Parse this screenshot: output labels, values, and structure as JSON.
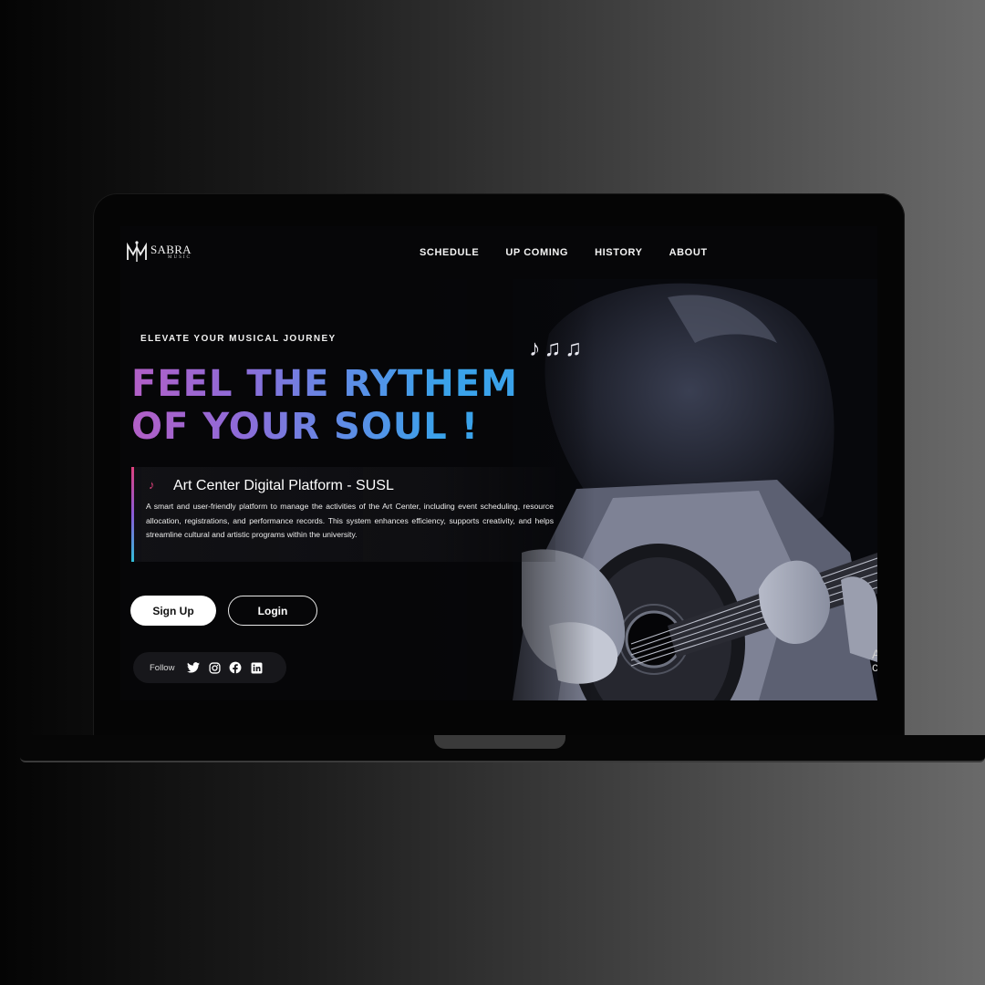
{
  "logo": {
    "name": "SABRA",
    "sub": "MUSIC"
  },
  "nav": {
    "items": [
      {
        "label": "SCHEDULE"
      },
      {
        "label": "UP COMING"
      },
      {
        "label": "HISTORY"
      },
      {
        "label": "ABOUT"
      }
    ]
  },
  "hero": {
    "eyebrow": "ELEVATE YOUR MUSICAL JOURNEY",
    "music_notes": "♪♫♫",
    "headline_line1": "FEEL THE RYTHEM",
    "headline_line2": "OF YOUR SOUL !",
    "gradient_colors": [
      "#b25fc6",
      "#8e6bd8",
      "#5f8ce6",
      "#3aa2ea"
    ]
  },
  "info": {
    "icon": "music-note-icon",
    "title": "Art Center Digital Platform - SUSL",
    "description": "A smart and user-friendly platform to manage the activities of the Art Center, including event scheduling, resource allocation, registrations, and performance records. This system enhances efficiency, supports creativity, and helps streamline cultural and artistic programs within the university."
  },
  "buttons": {
    "signup": "Sign Up",
    "login": "Login"
  },
  "follow": {
    "label": "Follow",
    "icons": [
      "twitter-icon",
      "instagram-icon",
      "facebook-icon",
      "linkedin-icon"
    ]
  },
  "colors": {
    "accent_pink": "#e0407c",
    "accent_cyan": "#2fc0d8"
  }
}
